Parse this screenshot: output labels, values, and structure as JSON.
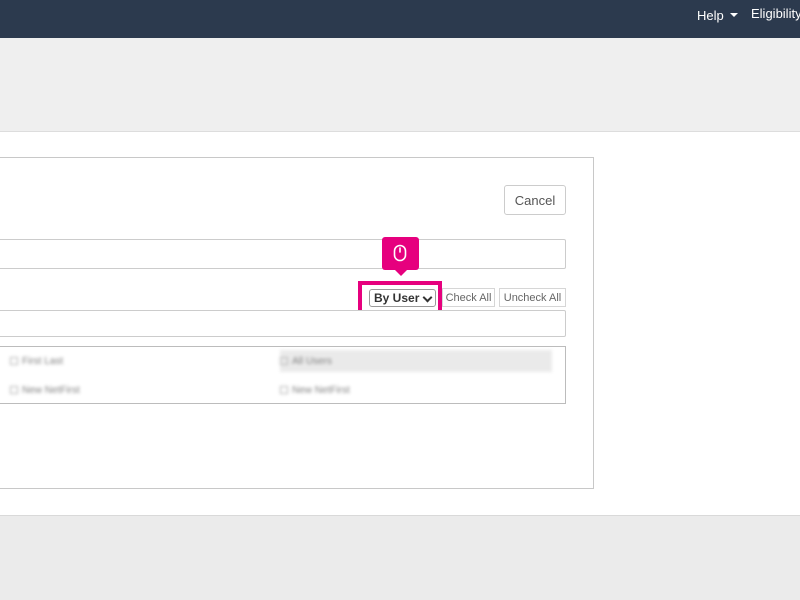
{
  "navbar": {
    "help_label": "Help",
    "eligibility_label": "Eligibility"
  },
  "dialog": {
    "cancel_label": "Cancel",
    "group_select_value": "By User",
    "check_all_label": "Check All",
    "uncheck_all_label": "Uncheck All",
    "list_items": [
      {
        "label": "First Last"
      },
      {
        "label": "All Users"
      },
      {
        "label": "New NetFirst"
      },
      {
        "label": "New NetFirst"
      }
    ]
  },
  "marker": {
    "icon": "mouse-icon",
    "color": "#e6007e"
  }
}
